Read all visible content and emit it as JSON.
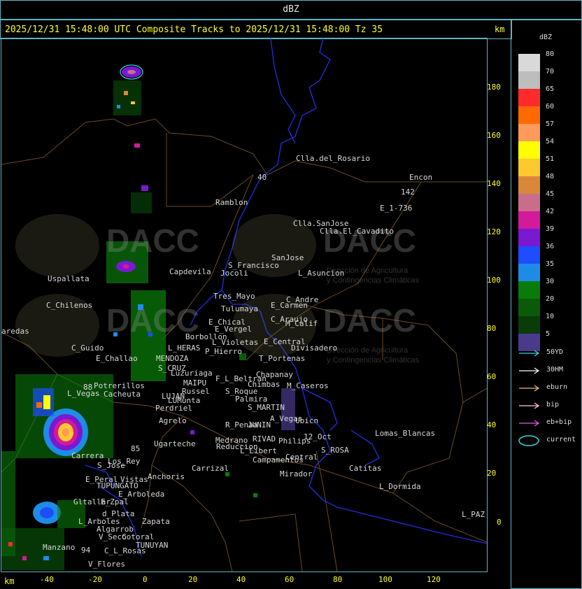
{
  "header": {
    "product": "dBZ",
    "title": "2025/12/31 15:48:00 UTC Composite Tracks to 2025/12/31 15:48:00 Tz 35",
    "unit_top": "km",
    "unit_bottom": "km"
  },
  "axes": {
    "y_ticks": [
      "180",
      "160",
      "140",
      "120",
      "100",
      "80",
      "60",
      "40",
      "20",
      "0"
    ],
    "x_ticks": [
      "-40",
      "-20",
      "0",
      "20",
      "40",
      "60",
      "80",
      "100",
      "120"
    ]
  },
  "legend": {
    "title": "dBZ",
    "levels": [
      {
        "label": "80",
        "color": "#d9d9d9"
      },
      {
        "label": "70",
        "color": "#bdbdbd"
      },
      {
        "label": "65",
        "color": "#ff2a2a"
      },
      {
        "label": "60",
        "color": "#ff6a00"
      },
      {
        "label": "57",
        "color": "#ff9a5a"
      },
      {
        "label": "54",
        "color": "#ffff00"
      },
      {
        "label": "51",
        "color": "#ffc830"
      },
      {
        "label": "48",
        "color": "#d9883a"
      },
      {
        "label": "45",
        "color": "#c86e8a"
      },
      {
        "label": "42",
        "color": "#d21a9a"
      },
      {
        "label": "39",
        "color": "#7a18d2"
      },
      {
        "label": "36",
        "color": "#1e4cff"
      },
      {
        "label": "35",
        "color": "#1e8ce6"
      },
      {
        "label": "30",
        "color": "#0a7a0a"
      },
      {
        "label": "20",
        "color": "#0a5a0a"
      },
      {
        "label": "10",
        "color": "#0a3c0a"
      },
      {
        "label": "5",
        "color": "#4a3a8a"
      }
    ],
    "tracks": [
      {
        "label": "50YD",
        "color": "#3ad6e6"
      },
      {
        "label": "30HM",
        "color": "#ffffff"
      },
      {
        "label": "eburn",
        "color": "#e8c070"
      },
      {
        "label": "bip",
        "color": "#ffd0d0"
      },
      {
        "label": "eb+bip",
        "color": "#e060e0"
      },
      {
        "label": "current",
        "color": "#3ad6e6"
      }
    ]
  },
  "places": [
    "Clla.del_Rosario",
    "Encon",
    "142",
    "E_1-736",
    "Ramblon",
    "Clla.SanJose",
    "Clla.El_Cavadito",
    "S_Francisco",
    "SanJose",
    "Capdevila",
    "Uspallata",
    "L_Asuncion",
    "Jocoli",
    "Tres_Mayo",
    "C_Andre",
    "Tulumaya",
    "E_Carmen",
    "C_Chilenos",
    "C_Araujo",
    "M_Calif",
    "E_Chical",
    "E_Vergel",
    "aredas",
    "Borbollon",
    "L_Violetas",
    "E_Central",
    "Divisadero",
    "C_Guido",
    "L_HERAS",
    "P_Hierro",
    "T_Portenas",
    "E_Challao",
    "MENDOZA",
    "S_CRUZ",
    "Luzuriaga",
    "F_L_Beltran",
    "Chapanay",
    "Potrerillos",
    "MAIPU",
    "Chimbas",
    "M_Caseros",
    "L_Vegas",
    "Cacheuta",
    "Russel",
    "S_Roque",
    "LUJAN",
    "Palmira",
    "LUMunta",
    "Perdriel",
    "S_MARTIN",
    "Agrelo",
    "A_Vegas",
    "Ubicn",
    "R_Penaa",
    "JUNIN",
    "Lomas_Blancas",
    "Ugarteche",
    "Medrano",
    "RIVAD",
    "Philips",
    "12_Oct",
    "S_ROSA",
    "Carrera",
    "Reduccion",
    "L_Libert",
    "Campamentos",
    "Central",
    "S_Jose",
    "Carrizal",
    "Catitas",
    "Anchoris",
    "E_Peral",
    "Vistas",
    "Mirador",
    "TUPUNGATO",
    "L_Dormida",
    "E_Arboleda",
    "Gltallar",
    "E_Zpal",
    "L_Arboles",
    "Zapata",
    "d_Plata",
    "L_PAZ",
    "Algarrob",
    "Cotoral",
    "V_Seco",
    "Manzano",
    "TUNUYAN",
    "C_L_Rosas",
    "V_Flores",
    "Los_Rey",
    "40",
    "88",
    "85",
    "94"
  ],
  "watermarks": [
    {
      "brand": "DACC",
      "sub1": "Dirección de Agricultura",
      "sub2": "y Contingencias Climáticas"
    }
  ]
}
